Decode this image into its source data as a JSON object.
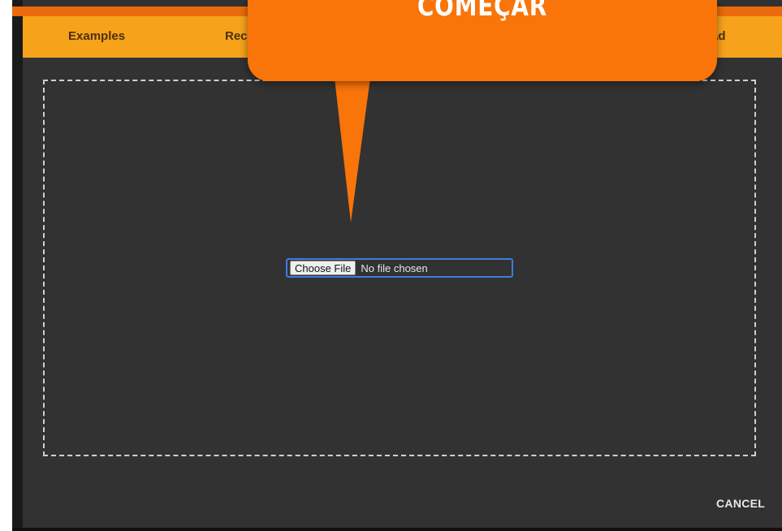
{
  "tabs": [
    {
      "label": "Examples"
    },
    {
      "label": "Rec"
    },
    {
      "label": "ad"
    }
  ],
  "file_input": {
    "button_label": "Choose File",
    "status": "No file chosen"
  },
  "dialog": {
    "cancel_label": "CANCEL"
  },
  "callout": {
    "text": "COMEÇAR"
  },
  "colors": {
    "topbar": "#f7a21b",
    "topbar_stripe": "#ea6a0c",
    "dialog_bg": "#323232",
    "callout": "#f97409",
    "focus_ring": "#3d7de0"
  }
}
